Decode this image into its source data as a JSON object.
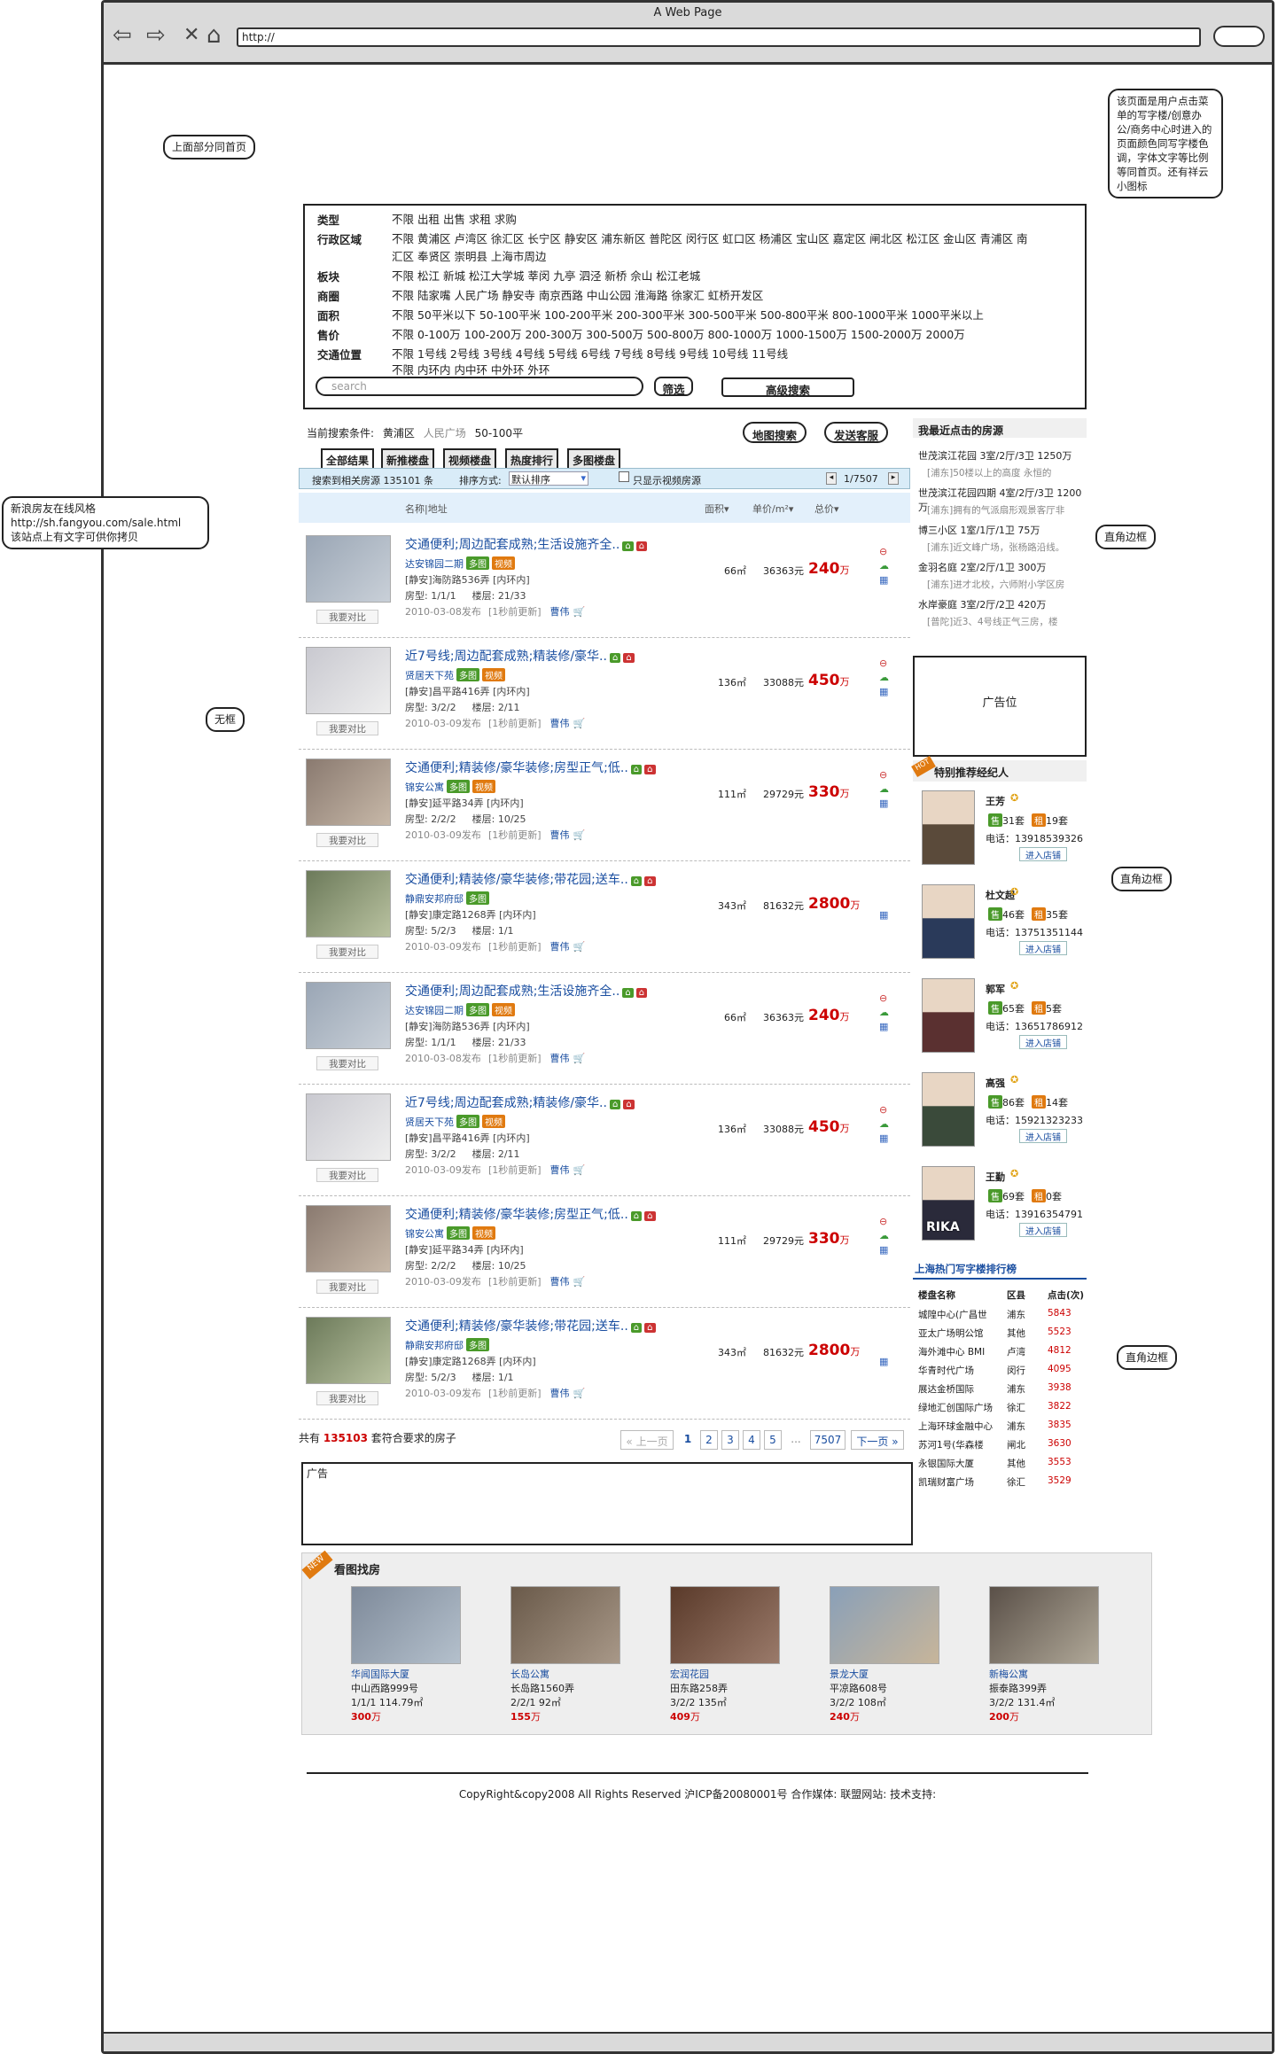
{
  "browser": {
    "title": "A Web Page",
    "url": "http://"
  },
  "notes": {
    "top_left": "上面部分同首页",
    "top_right": "该页面是用户点击菜单的写字楼/创意办公/商务中心时进入的页面颜色同写字楼色调，字体文字等比例等同首页。还有祥云小图标",
    "left_mid": [
      "新浪房友在线风格",
      "http://sh.fangyou.com/sale.html",
      "该站点上有文字可供你拷贝"
    ],
    "no_frame": "无框",
    "corner1": "直角边框",
    "corner2": "直角边框",
    "corner3": "直角边框"
  },
  "filters": [
    {
      "label": "类型",
      "values": "不限 出租 出售 求租 求购"
    },
    {
      "label": "行政区域",
      "values": "不限 黄浦区 卢湾区 徐汇区 长宁区 静安区 浦东新区 普陀区 闵行区 虹口区 杨浦区 宝山区 嘉定区 闸北区 松江区 金山区 青浦区 南汇区 奉贤区 崇明县 上海市周边"
    },
    {
      "label": "板块",
      "values": "不限 松江 新城 松江大学城 莘闵 九亭 泗泾 新桥 佘山 松江老城"
    },
    {
      "label": "商圈",
      "values": "不限 陆家嘴 人民广场 静安寺 南京西路 中山公园 淮海路 徐家汇 虹桥开发区"
    },
    {
      "label": "面积",
      "values": "不限 50平米以下 50-100平米 100-200平米 200-300平米 300-500平米 500-800平米 800-1000平米 1000平米以上"
    },
    {
      "label": "售价",
      "values": "不限 0-100万 100-200万 200-300万 300-500万 500-800万 800-1000万 1000-1500万 1500-2000万 2000万"
    },
    {
      "label": "交通位置",
      "values": "不限 1号线 2号线 3号线 4号线 5号线 6号线 7号线 8号线 9号线 10号线 11号线"
    },
    {
      "label": "",
      "values": "不限 内环内 内中环 中外环 外环"
    }
  ],
  "search": {
    "placeholder": "search",
    "filter_btn": "筛选",
    "advanced_btn": "高级搜索"
  },
  "current": {
    "label": "当前搜索条件:",
    "c1": "黄浦区",
    "c2": "人民广场",
    "c3": "50-100平",
    "map_btn": "地图搜索",
    "service_btn": "发送客服"
  },
  "tabs": [
    "全部结果",
    "新推楼盘",
    "视频楼盘",
    "热度排行",
    "多图楼盘"
  ],
  "sortbar": {
    "found": "搜索到相关房源 135101 条",
    "sort_label": "排序方式:",
    "sort_value": "默认排序",
    "video_only": "只显示视频房源",
    "page": "1/7507"
  },
  "columns": {
    "name": "名称|地址",
    "area": "面积",
    "unit": "单价/m²",
    "total": "总价"
  },
  "listings": [
    {
      "title": "交通便利;周边配套成熟;生活设施齐全..",
      "name": "达安锦园二期",
      "addr": "[静安]海防路536弄 [内环内]",
      "type": "房型: 1/1/1",
      "floor": "楼层: 21/33",
      "date": "2010-03-08发布",
      "upd": "[1秒前更新]",
      "agent": "曹伟",
      "area": "66㎡",
      "unit": "36363元",
      "price": "240",
      "wan": "万",
      "tags": [
        "多图",
        "视频"
      ]
    },
    {
      "title": "近7号线;周边配套成熟;精装修/豪华..",
      "name": "贤居天下苑",
      "addr": "[静安]昌平路416弄 [内环内]",
      "type": "房型: 3/2/2",
      "floor": "楼层: 2/11",
      "date": "2010-03-09发布",
      "upd": "[1秒前更新]",
      "agent": "曹伟",
      "area": "136㎡",
      "unit": "33088元",
      "price": "450",
      "wan": "万",
      "tags": [
        "多图",
        "视频"
      ]
    },
    {
      "title": "交通便利;精装修/豪华装修;房型正气;低..",
      "name": "锦安公寓",
      "addr": "[静安]延平路34弄 [内环内]",
      "type": "房型: 2/2/2",
      "floor": "楼层: 10/25",
      "date": "2010-03-09发布",
      "upd": "[1秒前更新]",
      "agent": "曹伟",
      "area": "111㎡",
      "unit": "29729元",
      "price": "330",
      "wan": "万",
      "tags": [
        "多图",
        "视频"
      ]
    },
    {
      "title": "交通便利;精装修/豪华装修;带花园;送车..",
      "name": "静鼎安邦府邸",
      "addr": "[静安]康定路1268弄 [内环内]",
      "type": "房型: 5/2/3",
      "floor": "楼层: 1/1",
      "date": "2010-03-09发布",
      "upd": "[1秒前更新]",
      "agent": "曹伟",
      "area": "343㎡",
      "unit": "81632元",
      "price": "2800",
      "wan": "万",
      "tags": [
        "多图"
      ]
    },
    {
      "title": "交通便利;周边配套成熟;生活设施齐全..",
      "name": "达安锦园二期",
      "addr": "[静安]海防路536弄 [内环内]",
      "type": "房型: 1/1/1",
      "floor": "楼层: 21/33",
      "date": "2010-03-08发布",
      "upd": "[1秒前更新]",
      "agent": "曹伟",
      "area": "66㎡",
      "unit": "36363元",
      "price": "240",
      "wan": "万",
      "tags": [
        "多图",
        "视频"
      ]
    },
    {
      "title": "近7号线;周边配套成熟;精装修/豪华..",
      "name": "贤居天下苑",
      "addr": "[静安]昌平路416弄 [内环内]",
      "type": "房型: 3/2/2",
      "floor": "楼层: 2/11",
      "date": "2010-03-09发布",
      "upd": "[1秒前更新]",
      "agent": "曹伟",
      "area": "136㎡",
      "unit": "33088元",
      "price": "450",
      "wan": "万",
      "tags": [
        "多图",
        "视频"
      ]
    },
    {
      "title": "交通便利;精装修/豪华装修;房型正气;低..",
      "name": "锦安公寓",
      "addr": "[静安]延平路34弄 [内环内]",
      "type": "房型: 2/2/2",
      "floor": "楼层: 10/25",
      "date": "2010-03-09发布",
      "upd": "[1秒前更新]",
      "agent": "曹伟",
      "area": "111㎡",
      "unit": "29729元",
      "price": "330",
      "wan": "万",
      "tags": [
        "多图",
        "视频"
      ]
    },
    {
      "title": "交通便利;精装修/豪华装修;带花园;送车..",
      "name": "静鼎安邦府邸",
      "addr": "[静安]康定路1268弄 [内环内]",
      "type": "房型: 5/2/3",
      "floor": "楼层: 1/1",
      "date": "2010-03-09发布",
      "upd": "[1秒前更新]",
      "agent": "曹伟",
      "area": "343㎡",
      "unit": "81632元",
      "price": "2800",
      "wan": "万",
      "tags": [
        "多图"
      ]
    }
  ],
  "compare_label": "我要对比",
  "total": {
    "pre": "共有",
    "count": "135103",
    "post": "套符合要求的房子"
  },
  "pager": {
    "prev": "« 上一页",
    "pages": [
      "1",
      "2",
      "3",
      "4",
      "5"
    ],
    "dots": "...",
    "last": "7507",
    "next": "下一页 »"
  },
  "ad_label": "广告",
  "recent": {
    "title": "我最近点击的房源",
    "items": [
      {
        "t": "世茂滨江花园 3室/2厅/3卫 1250万",
        "d": "[浦东]50楼以上的高度 永恒的"
      },
      {
        "t": "世茂滨江花园四期 4室/2厅/3卫 1200万",
        "d": "[浦东]拥有的气派扇形观景客厅非"
      },
      {
        "t": "博三小区 1室/1厅/1卫 75万",
        "d": "[浦东]近文峰广场，张杨路沿线。"
      },
      {
        "t": "金羽名庭 2室/2厅/1卫 300万",
        "d": "[浦东]进才北校，六师附小学区房"
      },
      {
        "t": "水岸豪庭 3室/2厅/2卫 420万",
        "d": "[普陀]近3、4号线正气三房，楼"
      }
    ]
  },
  "ad_box": "广告位",
  "agents": {
    "title": "特别推荐经纪人",
    "hot": "HOT",
    "phone_label": "电话：",
    "unit": "套",
    "store_btn": "进入店铺",
    "list": [
      {
        "name": "王芳",
        "sale": "31",
        "rent": "19",
        "phone": "13918539326"
      },
      {
        "name": "杜文超",
        "sale": "46",
        "rent": "35",
        "phone": "13751351144"
      },
      {
        "name": "郭军",
        "sale": "65",
        "rent": "5",
        "phone": "13651786912"
      },
      {
        "name": "高强",
        "sale": "86",
        "rent": "14",
        "phone": "15921323233"
      },
      {
        "name": "王勤",
        "sale": "69",
        "rent": "0",
        "phone": "13916354791"
      }
    ],
    "rika": "RIKA"
  },
  "ranking": {
    "title": "上海热门写字楼排行榜",
    "cols": [
      "楼盘名称",
      "区县",
      "点击(次)"
    ],
    "rows": [
      [
        "城隍中心(广昌世",
        "浦东",
        "5843"
      ],
      [
        "亚太广场明公馆",
        "其他",
        "5523"
      ],
      [
        "海外滩中心 BMI",
        "卢湾",
        "4812"
      ],
      [
        "华青时代广场",
        "闵行",
        "4095"
      ],
      [
        "展达金桥国际",
        "浦东",
        "3938"
      ],
      [
        "绿地汇创国际广场",
        "徐汇",
        "3822"
      ],
      [
        "上海环球金融中心",
        "浦东",
        "3835"
      ],
      [
        "苏河1号(华森楼",
        "闸北",
        "3630"
      ],
      [
        "永银国际大厦",
        "其他",
        "3553"
      ],
      [
        "凯瑞财富广场",
        "徐汇",
        "3529"
      ]
    ]
  },
  "gallery": {
    "title": "看图找房",
    "new": "NEW",
    "items": [
      {
        "name": "华闻国际大厦",
        "addr": "中山西路999号",
        "spec": "1/1/1   114.79㎡",
        "price": "300",
        "wan": "万"
      },
      {
        "name": "长岛公寓",
        "addr": "长岛路1560弄",
        "spec": "2/2/1   92㎡",
        "price": "155",
        "wan": "万"
      },
      {
        "name": "宏润花园",
        "addr": "田东路258弄",
        "spec": "3/2/2   135㎡",
        "price": "409",
        "wan": "万"
      },
      {
        "name": "景龙大厦",
        "addr": "平凉路608号",
        "spec": "3/2/2   108㎡",
        "price": "240",
        "wan": "万"
      },
      {
        "name": "新梅公寓",
        "addr": "振泰路399弄",
        "spec": "3/2/2   131.4㎡",
        "price": "200",
        "wan": "万"
      }
    ]
  },
  "footer": "CopyRight&copy2008 All Rights Reserved 沪ICP备20080001号 合作媒体:  联盟网站: 技术支持:",
  "colors": {
    "link": "#1a4ea0",
    "price": "#cc0000",
    "green_tag": "#4a9a2a",
    "orange_tag": "#e07a10"
  }
}
